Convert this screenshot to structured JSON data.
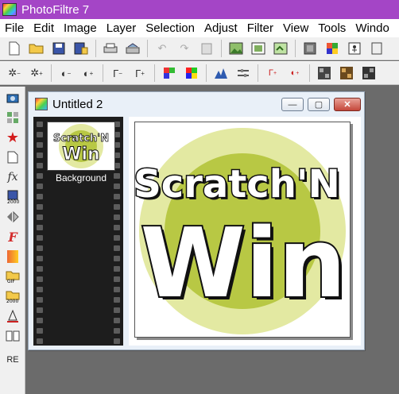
{
  "app": {
    "title": "PhotoFiltre 7"
  },
  "menu": [
    "File",
    "Edit",
    "Image",
    "Layer",
    "Selection",
    "Adjust",
    "Filter",
    "View",
    "Tools",
    "Windo"
  ],
  "toolbar1": [
    "new-icon",
    "open-icon",
    "save-icon",
    "save-as-icon",
    "print-icon",
    "scan-icon",
    "undo-icon",
    "redo-icon",
    "paste-icon",
    "image-size-icon",
    "canvas-size-icon",
    "gradient-icon",
    "frame-icon",
    "color-palette-icon",
    "filter-icon",
    "exit-icon"
  ],
  "toolbar2": [
    "brightness-up-icon",
    "brightness-down-icon",
    "contrast-down-icon",
    "contrast-up-icon",
    "gamma-down-icon",
    "gamma-up-icon",
    "saturation-down-icon",
    "saturation-up-icon",
    "histogram-icon",
    "levels-icon",
    "auto-gamma-icon",
    "auto-levels-icon",
    "pattern-1-icon",
    "pattern-2-icon",
    "pattern-3-icon"
  ],
  "left_tools": [
    "camera-icon",
    "layers-icon",
    "star-icon",
    "page-icon",
    "fx-icon",
    "save-2000-icon",
    "mirror-icon",
    "script-icon",
    "gradient-bar-icon",
    "gif-folder-icon",
    "folder-2000-icon",
    "text-tool-icon",
    "book-icon"
  ],
  "left_tools_label": "RE",
  "document": {
    "title": "Untitled 2",
    "min_glyph": "—",
    "max_glyph": "▢",
    "close_glyph": "✕",
    "layer_name": "Background",
    "logo_line1": "Scratch'N",
    "logo_line2": "Win"
  },
  "colors": {
    "titlebar": "#a445c6",
    "logo_green": "#b8c844",
    "logo_light": "#e3e9a2"
  }
}
